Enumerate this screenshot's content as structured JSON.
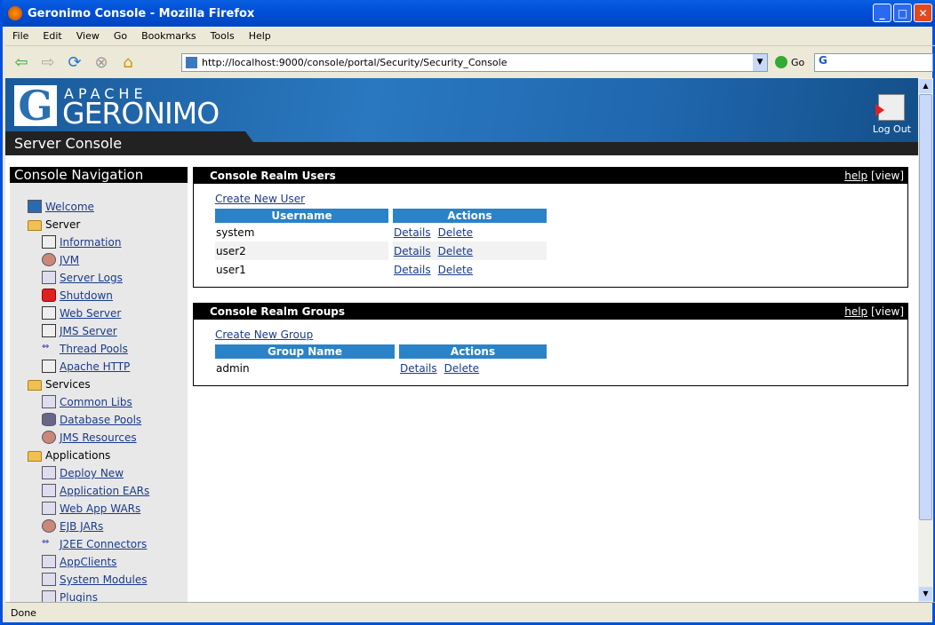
{
  "window": {
    "title": "Geronimo Console - Mozilla Firefox"
  },
  "menu": [
    "File",
    "Edit",
    "View",
    "Go",
    "Bookmarks",
    "Tools",
    "Help"
  ],
  "toolbar": {
    "url": "http://localhost:9000/console/portal/Security/Security_Console",
    "go": "Go",
    "search_logo": "G"
  },
  "banner": {
    "apache": "APACHE",
    "geronimo": "GERONIMO",
    "logo_letter": "G",
    "server_console": "Server Console",
    "logout": "Log Out"
  },
  "nav": {
    "title": "Console Navigation",
    "items": [
      {
        "label": "Welcome",
        "level": 0,
        "icon": "g"
      },
      {
        "label": "Server",
        "level": 0,
        "icon": "folder",
        "folder": true
      },
      {
        "label": "Information",
        "level": 1,
        "icon": "mon"
      },
      {
        "label": "JVM",
        "level": 1,
        "icon": "gear"
      },
      {
        "label": "Server Logs",
        "level": 1,
        "icon": "list"
      },
      {
        "label": "Shutdown",
        "level": 1,
        "icon": "x"
      },
      {
        "label": "Web Server",
        "level": 1,
        "icon": "mon"
      },
      {
        "label": "JMS Server",
        "level": 1,
        "icon": "mon"
      },
      {
        "label": "Thread Pools",
        "level": 1,
        "icon": "lnk"
      },
      {
        "label": "Apache HTTP",
        "level": 1,
        "icon": "mon"
      },
      {
        "label": "Services",
        "level": 0,
        "icon": "folder",
        "folder": true
      },
      {
        "label": "Common Libs",
        "level": 1,
        "icon": "list"
      },
      {
        "label": "Database Pools",
        "level": 1,
        "icon": "db"
      },
      {
        "label": "JMS Resources",
        "level": 1,
        "icon": "gear"
      },
      {
        "label": "Applications",
        "level": 0,
        "icon": "folder",
        "folder": true
      },
      {
        "label": "Deploy New",
        "level": 1,
        "icon": "list"
      },
      {
        "label": "Application EARs",
        "level": 1,
        "icon": "list"
      },
      {
        "label": "Web App WARs",
        "level": 1,
        "icon": "list"
      },
      {
        "label": "EJB JARs",
        "level": 1,
        "icon": "gear"
      },
      {
        "label": "J2EE Connectors",
        "level": 1,
        "icon": "lnk"
      },
      {
        "label": "AppClients",
        "level": 1,
        "icon": "list"
      },
      {
        "label": "System Modules",
        "level": 1,
        "icon": "list"
      },
      {
        "label": "Plugins",
        "level": 1,
        "icon": "list"
      }
    ]
  },
  "users": {
    "title": "Console Realm Users",
    "help": "help",
    "view": "[view]",
    "create": "Create New User",
    "col1": "Username",
    "col2": "Actions",
    "details": "Details",
    "delete": "Delete",
    "rows": [
      "system",
      "user2",
      "user1"
    ]
  },
  "groups": {
    "title": "Console Realm Groups",
    "help": "help",
    "view": "[view]",
    "create": "Create New Group",
    "col1": "Group Name",
    "col2": "Actions",
    "details": "Details",
    "delete": "Delete",
    "rows": [
      "admin"
    ]
  },
  "status": "Done"
}
